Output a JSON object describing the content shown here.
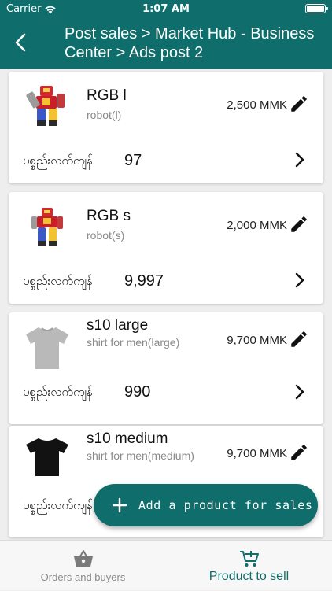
{
  "status_bar": {
    "carrier": "Carrier",
    "time": "1:07 AM"
  },
  "app_bar": {
    "title": "Post sales > Market Hub - Business Center > Ads post 2",
    "back_icon": "back-arrow-icon"
  },
  "theme": {
    "primary": "#0f6e6b",
    "background": "#eeeeee"
  },
  "products": [
    {
      "name": "RGB l",
      "description": "robot(l)",
      "price": "2,500 MMK",
      "stock_label": "ပစ္စည်းလက်ကျန်",
      "stock": "97",
      "thumb": "robot-large"
    },
    {
      "name": "RGB s",
      "description": "robot(s)",
      "price": "2,000 MMK",
      "stock_label": "ပစ္စည်းလက်ကျန်",
      "stock": "9,997",
      "thumb": "robot-small"
    },
    {
      "name": "s10 large",
      "description": "shirt for men(large)",
      "price": "9,700 MMK",
      "stock_label": "ပစ္စည်းလက်ကျန်",
      "stock": "990",
      "thumb": "grey-tshirt"
    },
    {
      "name": "s10 medium",
      "description": "shirt for men(medium)",
      "price": "9,700 MMK",
      "stock_label": "ပစ္စည်းလက်ကျန်",
      "stock": "",
      "thumb": "black-tshirt"
    }
  ],
  "fab": {
    "label": "Add a product for sales",
    "icon": "plus-icon"
  },
  "bottom_nav": {
    "items": [
      {
        "label": "Orders and buyers",
        "icon": "basket-icon",
        "active": false
      },
      {
        "label": "Product to sell",
        "icon": "cart-plus-icon",
        "active": true
      }
    ]
  }
}
